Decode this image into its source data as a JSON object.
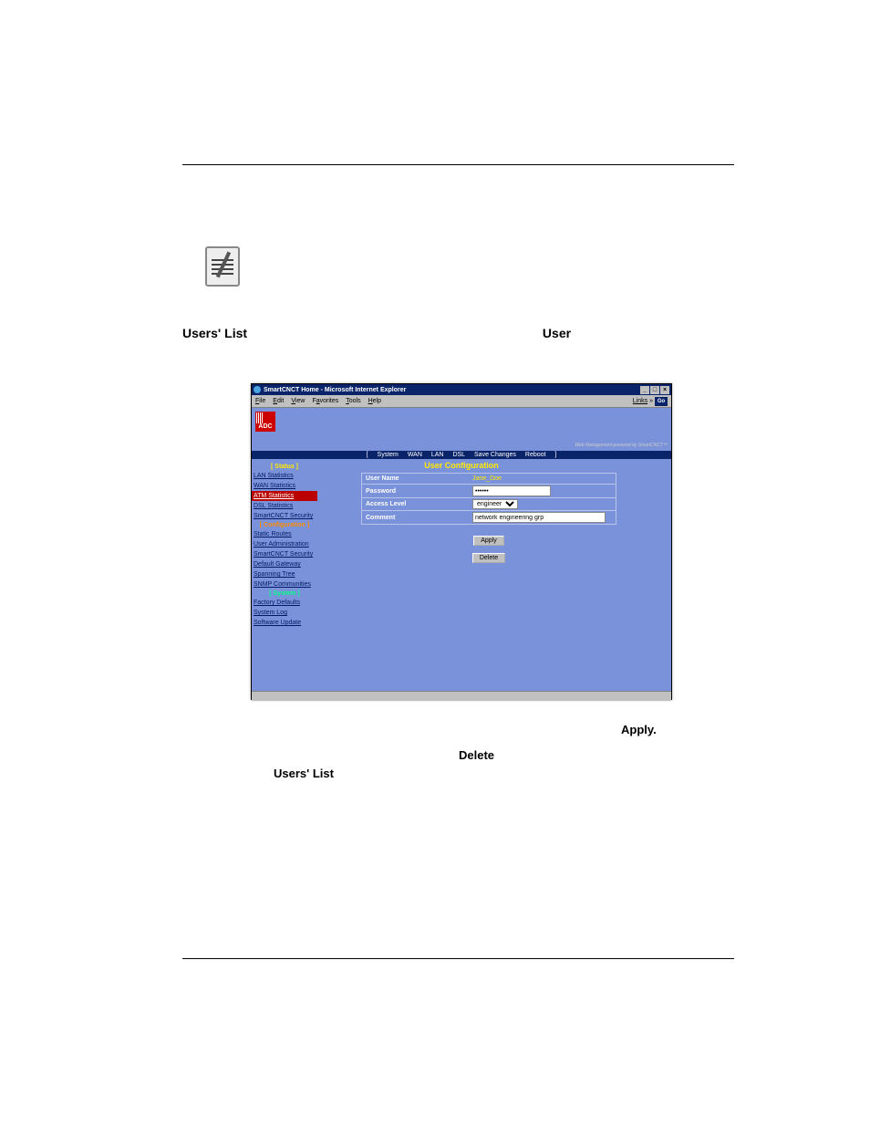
{
  "document": {
    "line1_a": "Users' List",
    "line1_b": "User",
    "line2": "Apply.",
    "line3": "Delete",
    "line4": "Users' List"
  },
  "browser": {
    "title": "SmartCNCT Home - Microsoft Internet Explorer",
    "menus": {
      "file": "File",
      "edit": "Edit",
      "view": "View",
      "favorites": "Favorites",
      "tools": "Tools",
      "help": "Help"
    },
    "links_label": "Links",
    "go_label": "Go",
    "adc_logo": "ADC",
    "powered": "Web Management powered by SmartCNCT™",
    "topnav": {
      "open": "[",
      "system": "System",
      "wan": "WAN",
      "lan": "LAN",
      "dsl": "DSL",
      "save": "Save Changes",
      "reboot": "Reboot",
      "close": "]"
    },
    "page_title": "User Configuration",
    "sidebar": {
      "status_hdr": "[ Status ]",
      "config_hdr": "[ Configuration ]",
      "system_hdr": "[ System ]",
      "items": {
        "lan": "LAN Statistics",
        "wan": "WAN Statistics",
        "atm": "ATM Statistics",
        "dsl": "DSL Statistics",
        "sec1": "SmartCNCT Security",
        "routes": "Static Routes",
        "useradmin": "User Administration",
        "sec2": "SmartCNCT Security",
        "gateway": "Default Gateway",
        "spanning": "Spanning Tree",
        "snmp": "SNMP Communities",
        "factory": "Factory Defaults",
        "syslog": "System Log",
        "software": "Software Update"
      }
    },
    "form": {
      "user_name_label": "User Name",
      "user_name_value": "Jane_Doe",
      "password_label": "Password",
      "password_value": "••••••",
      "access_label": "Access Level",
      "access_value": "engineer",
      "comment_label": "Comment",
      "comment_value": "network engineering grp",
      "apply_btn": "Apply",
      "delete_btn": "Delete"
    }
  }
}
